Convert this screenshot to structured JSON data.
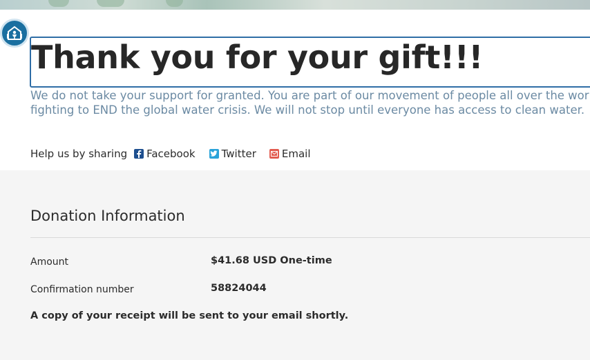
{
  "accessibility": {
    "icon": "accessibility-icon",
    "color": "#1a6fa0"
  },
  "thank_you": {
    "title": "Thank you for your gift!!!",
    "subtitle_line1": "We do not take your support for granted. You are part of our movement of people all over the world",
    "subtitle_line2": "fighting to END the global water crisis. We will not stop until everyone has access to clean water."
  },
  "share": {
    "label": "Help us by sharing",
    "facebook": "Facebook",
    "twitter": "Twitter",
    "email": "Email"
  },
  "donation": {
    "heading": "Donation Information",
    "amount_label": "Amount",
    "amount_value": "$41.68 USD One-time",
    "confirmation_label": "Confirmation number",
    "confirmation_value": "58824044",
    "receipt_note": "A copy of your receipt will be sent to your email shortly."
  },
  "colors": {
    "facebook": "#1e4f8f",
    "twitter": "#2aa3d9",
    "email": "#e25b4f",
    "subtitle_text": "#6b8aa3",
    "focus_border": "#2e6da6"
  }
}
